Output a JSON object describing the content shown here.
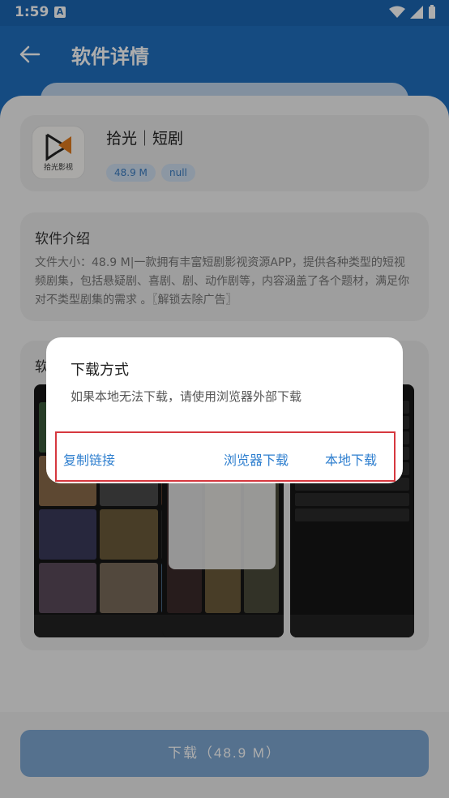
{
  "status_bar": {
    "time": "1:59",
    "notif_icon": "A"
  },
  "app_bar": {
    "title": "软件详情"
  },
  "app": {
    "name": "拾光｜短剧",
    "logo_text": "拾光影视",
    "size_badge": "48.9 M",
    "category_badge": "null"
  },
  "intro": {
    "title": "软件介绍",
    "text": "文件大小：48.9 M|一款拥有丰富短剧影视资源APP，提供各种类型的短视频剧集，包括悬疑剧、喜剧、剧、动作剧等，内容涵盖了各个题材，满足你对不类型剧集的需求 。〖解锁去除广告〗"
  },
  "screenshots": {
    "title_partial": "软"
  },
  "dialog": {
    "title": "下载方式",
    "message": "如果本地无法下载，请使用浏览器外部下载",
    "copy_link": "复制链接",
    "browser_download": "浏览器下载",
    "local_download": "本地下载"
  },
  "download_button": "下载（48.9 M）",
  "colors": {
    "primary": "#1f6fbf",
    "dialog_button": "#2f7fcf",
    "highlight_border": "#d6383f"
  }
}
